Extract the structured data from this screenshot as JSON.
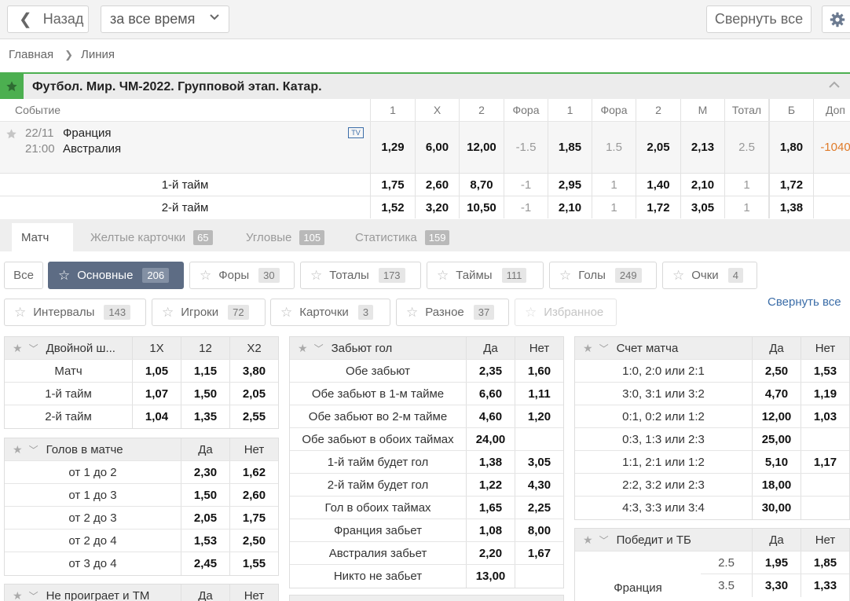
{
  "topbar": {
    "back_label": "Назад",
    "period_label": "за все время",
    "collapse_label": "Свернуть все"
  },
  "breadcrumb": {
    "home": "Главная",
    "current": "Линия"
  },
  "league": {
    "title": "Футбол. Мир. ЧМ-2022. Групповой этап. Катар."
  },
  "odds": {
    "columns": [
      "Событие",
      "1",
      "X",
      "2",
      "Фора",
      "1",
      "Фора",
      "2",
      "М",
      "Тотал",
      "Б",
      "Доп"
    ],
    "event": {
      "date": "22/11",
      "time": "21:00",
      "team1": "Франция",
      "team2": "Австралия",
      "tv": "TV",
      "values": [
        "1,29",
        "6,00",
        "12,00",
        "-1.5",
        "1,85",
        "1.5",
        "2,05",
        "2,13",
        "2.5",
        "1,80",
        "-1040"
      ]
    },
    "halves": [
      {
        "label": "1-й тайм",
        "values": [
          "1,75",
          "2,60",
          "8,70",
          "-1",
          "2,95",
          "1",
          "1,40",
          "2,10",
          "1",
          "1,72",
          ""
        ]
      },
      {
        "label": "2-й тайм",
        "values": [
          "1,52",
          "3,20",
          "10,50",
          "-1",
          "2,10",
          "1",
          "1,72",
          "3,05",
          "1",
          "1,38",
          ""
        ]
      }
    ]
  },
  "tabs": [
    {
      "label": "Матч",
      "count": ""
    },
    {
      "label": "Желтые карточки",
      "count": "65"
    },
    {
      "label": "Угловые",
      "count": "105"
    },
    {
      "label": "Статистика",
      "count": "159"
    }
  ],
  "filters": {
    "row1": [
      {
        "label": "Все",
        "count": ""
      },
      {
        "label": "Основные",
        "count": "206"
      },
      {
        "label": "Форы",
        "count": "30"
      },
      {
        "label": "Тоталы",
        "count": "173"
      },
      {
        "label": "Таймы",
        "count": "111"
      },
      {
        "label": "Голы",
        "count": "249"
      },
      {
        "label": "Очки",
        "count": "4"
      }
    ],
    "row2": [
      {
        "label": "Интервалы",
        "count": "143"
      },
      {
        "label": "Игроки",
        "count": "72"
      },
      {
        "label": "Карточки",
        "count": "3"
      },
      {
        "label": "Разное",
        "count": "37"
      },
      {
        "label": "Избранное",
        "count": ""
      }
    ],
    "collapse_all": "Свернуть все"
  },
  "markets": {
    "double_chance": {
      "title": "Двойной ш...",
      "headers": [
        "1X",
        "12",
        "X2"
      ],
      "rows": [
        {
          "label": "Матч",
          "values": [
            "1,05",
            "1,15",
            "3,80"
          ]
        },
        {
          "label": "1-й тайм",
          "values": [
            "1,07",
            "1,50",
            "2,05"
          ]
        },
        {
          "label": "2-й тайм",
          "values": [
            "1,04",
            "1,35",
            "2,55"
          ]
        }
      ]
    },
    "goals_in_match": {
      "title": "Голов в матче",
      "headers": [
        "Да",
        "Нет"
      ],
      "rows": [
        {
          "label": "от 1 до 2",
          "values": [
            "2,30",
            "1,62"
          ]
        },
        {
          "label": "от 1 до 3",
          "values": [
            "1,50",
            "2,60"
          ]
        },
        {
          "label": "от 2 до 3",
          "values": [
            "2,05",
            "1,75"
          ]
        },
        {
          "label": "от 2 до 4",
          "values": [
            "1,53",
            "2,50"
          ]
        },
        {
          "label": "от 3 до 4",
          "values": [
            "2,45",
            "1,55"
          ]
        }
      ]
    },
    "not_lose_tm": {
      "title": "Не проиграет и ТМ",
      "headers": [
        "Да",
        "Нет"
      ]
    },
    "will_score": {
      "title": "Забьют гол",
      "headers": [
        "Да",
        "Нет"
      ],
      "rows": [
        {
          "label": "Обе забьют",
          "values": [
            "2,35",
            "1,60"
          ]
        },
        {
          "label": "Обе забьют в 1-м тайме",
          "values": [
            "6,60",
            "1,11"
          ]
        },
        {
          "label": "Обе забьют во 2-м тайме",
          "values": [
            "4,60",
            "1,20"
          ]
        },
        {
          "label": "Обе забьют в обоих таймах",
          "values": [
            "24,00",
            ""
          ]
        },
        {
          "label": "1-й тайм будет гол",
          "values": [
            "1,38",
            "3,05"
          ]
        },
        {
          "label": "2-й тайм будет гол",
          "values": [
            "1,22",
            "4,30"
          ]
        },
        {
          "label": "Гол в обоих таймах",
          "values": [
            "1,65",
            "2,25"
          ]
        },
        {
          "label": "Франция забьет",
          "values": [
            "1,08",
            "8,00"
          ]
        },
        {
          "label": "Австралия забьет",
          "values": [
            "2,20",
            "1,67"
          ]
        },
        {
          "label": "Никто не забьет",
          "values": [
            "13,00",
            ""
          ]
        }
      ]
    },
    "score": {
      "title": "Счет матча",
      "headers": [
        "Да",
        "Нет"
      ],
      "rows": [
        {
          "label": "1:0, 2:0 или 2:1",
          "values": [
            "2,50",
            "1,53"
          ]
        },
        {
          "label": "3:0, 3:1 или 3:2",
          "values": [
            "4,70",
            "1,19"
          ]
        },
        {
          "label": "0:1, 0:2 или 1:2",
          "values": [
            "12,00",
            "1,03"
          ]
        },
        {
          "label": "0:3, 1:3 или 2:3",
          "values": [
            "25,00",
            ""
          ]
        },
        {
          "label": "1:1, 2:1 или 1:2",
          "values": [
            "5,10",
            "1,17"
          ]
        },
        {
          "label": "2:2, 3:2 или 2:3",
          "values": [
            "18,00",
            ""
          ]
        },
        {
          "label": "4:3, 3:3 или 3:4",
          "values": [
            "30,00",
            ""
          ]
        }
      ]
    },
    "win_and_tb": {
      "title": "Победит и ТБ",
      "headers": [
        "Да",
        "Нет"
      ],
      "team": "Франция",
      "rows": [
        {
          "total": "2.5",
          "values": [
            "1,95",
            "1,85"
          ]
        },
        {
          "total": "3.5",
          "values": [
            "3,30",
            "1,33"
          ]
        }
      ]
    }
  },
  "colors": {
    "accent_green": "#4caf50",
    "selected_pill": "#5d6c84",
    "link": "#3b6da8",
    "orange": "#e07b2a"
  }
}
